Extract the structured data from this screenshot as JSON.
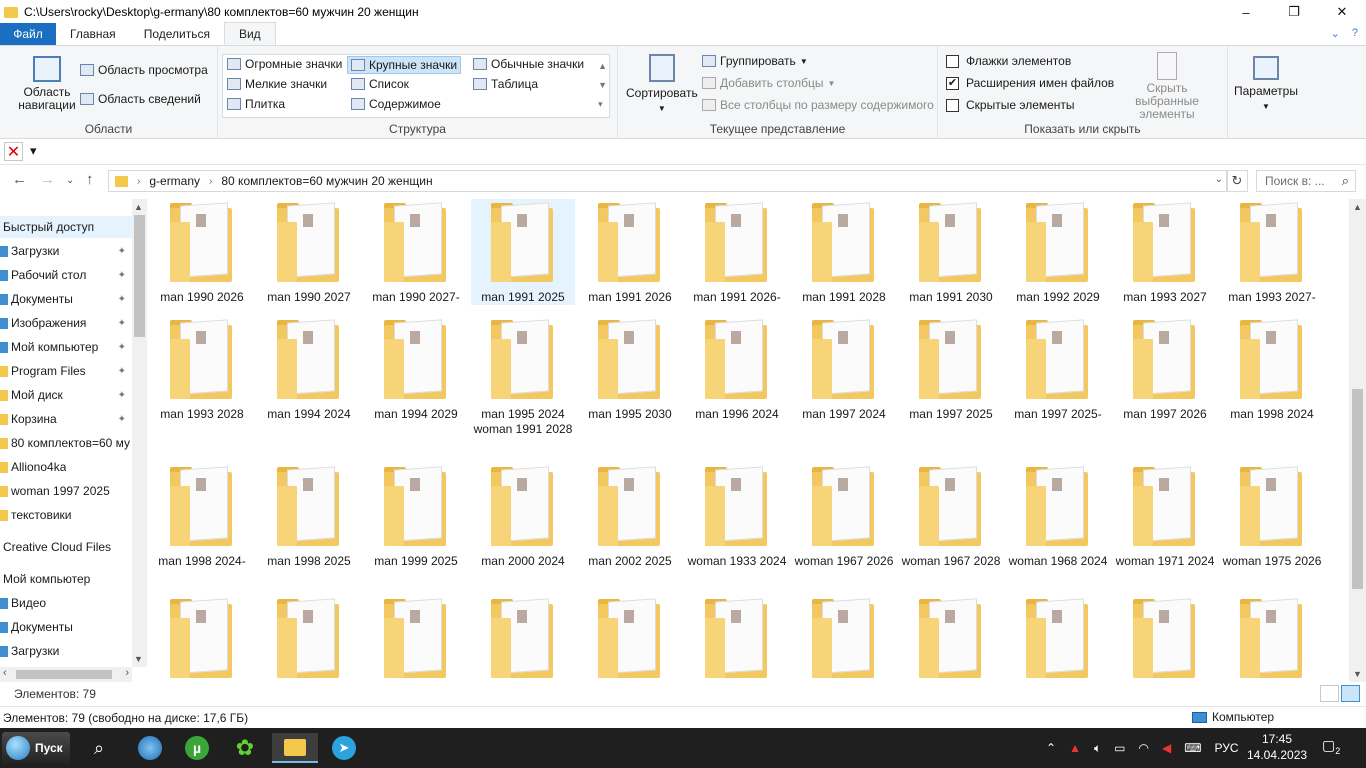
{
  "window": {
    "title": "C:\\Users\\rocky\\Desktop\\g-ermany\\80 комплектов=60 мужчин 20 женщин",
    "controls": [
      "–",
      "❐",
      "✕"
    ]
  },
  "ribbon": {
    "tabs": [
      "Файл",
      "Главная",
      "Поделиться",
      "Вид"
    ],
    "areas": {
      "label": "Области",
      "nav_pane": "Область навигации",
      "preview_pane": "Область просмотра",
      "details_pane": "Область сведений"
    },
    "structure": {
      "label": "Структура",
      "items": [
        "Огромные значки",
        "Крупные значки",
        "Обычные значки",
        "Мелкие значки",
        "Список",
        "Таблица",
        "Плитка",
        "Содержимое"
      ],
      "selected": "Крупные значки"
    },
    "current_view": {
      "label": "Текущее представление",
      "sort": "Сортировать",
      "group": "Группировать",
      "add_columns": "Добавить столбцы",
      "fit_columns": "Все столбцы по размеру содержимого"
    },
    "show_hide": {
      "label": "Показать или скрыть",
      "item_checkboxes": "Флажки элементов",
      "file_extensions": "Расширения имен файлов",
      "hidden_items": "Скрытые элементы",
      "hide_selected": "Скрыть выбранные элементы",
      "file_extensions_checked": true
    },
    "options": "Параметры"
  },
  "address": {
    "crumbs": [
      "g-ermany",
      "80 комплектов=60 мужчин 20 женщин"
    ],
    "search_placeholder": "Поиск в: ..."
  },
  "sidebar": {
    "quick_access": "Быстрый доступ",
    "pinned": [
      "Загрузки",
      "Рабочий стол",
      "Документы",
      "Изображения",
      "Мой компьютер",
      "Program Files",
      "Мой диск",
      "Корзина"
    ],
    "recent": [
      "80 комплектов=60 му",
      "Alliono4ka",
      "woman 1997 2025",
      "текстовики"
    ],
    "creative_cloud": "Creative Cloud Files",
    "my_computer": "Мой компьютер",
    "computer_items": [
      "Видео",
      "Документы",
      "Загрузки"
    ]
  },
  "folders": [
    [
      "man 1990 2026",
      "man 1990 2027",
      "man 1990 2027-",
      "man 1991 2025",
      "man 1991 2026",
      "man 1991 2026-",
      "man 1991 2028",
      "man 1991 2030",
      "man 1992 2029",
      "man 1993 2027",
      "man 1993 2027-"
    ],
    [
      "man 1993 2028",
      "man 1994 2024",
      "man 1994 2029",
      "man 1995 2024 woman 1991 2028",
      "man 1995 2030",
      "man 1996 2024",
      "man 1997 2024",
      "man 1997 2025",
      "man 1997 2025-",
      "man 1997 2026",
      "man 1998 2024"
    ],
    [
      "man 1998 2024-",
      "man 1998 2025",
      "man 1999 2025",
      "man 2000 2024",
      "man 2002 2025",
      "woman 1933 2024",
      "woman 1967 2026",
      "woman 1967 2028",
      "woman 1968 2024",
      "woman 1971 2024",
      "woman 1975 2026"
    ],
    [
      "",
      "",
      "",
      "",
      "",
      "",
      "",
      "",
      "",
      "",
      ""
    ]
  ],
  "selected_folder": "man 1991 2025",
  "status": {
    "items_count": "Элементов: 79",
    "info": "Элементов: 79 (свободно на диске: 17,6 ГБ)",
    "computer": "Компьютер"
  },
  "taskbar": {
    "start": "Пуск",
    "language": "РУС",
    "time": "17:45",
    "date": "14.04.2023",
    "notifications": "2"
  }
}
